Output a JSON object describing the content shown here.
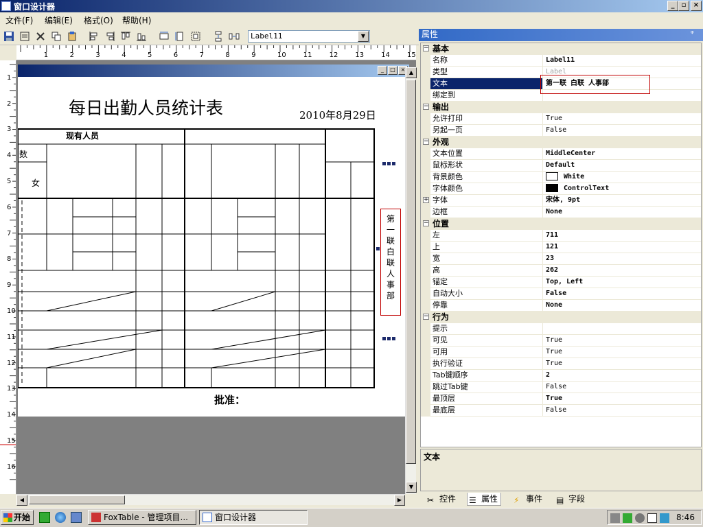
{
  "window": {
    "title": "窗口设计器",
    "btn_min": "_",
    "btn_restore": "▫",
    "btn_close": "×"
  },
  "menu": {
    "items": [
      "文件(F)",
      "编辑(E)",
      "格式(O)",
      "帮助(H)"
    ]
  },
  "toolbar": {
    "selected_control": "Label11"
  },
  "ruler": {
    "h_labels": [
      "1",
      "2",
      "3",
      "4",
      "5",
      "6",
      "7",
      "8",
      "9",
      "10",
      "11",
      "12",
      "13",
      "14",
      "15"
    ],
    "v_labels": [
      "1",
      "2",
      "3",
      "4",
      "5",
      "6",
      "7",
      "8",
      "9",
      "10",
      "11",
      "12",
      "13",
      "14",
      "15",
      "16"
    ]
  },
  "form": {
    "title": "每日出勤人员统计表",
    "date": "2010年8月29日",
    "col_current": "现有人员",
    "cell_shu": "数",
    "cell_nv": "女",
    "approve": "批准：",
    "label11_text": "第一联白联人事部"
  },
  "props": {
    "header": "属性",
    "pin": "ᵠ",
    "categories": {
      "basic": "基本",
      "output": "输出",
      "appearance": "外观",
      "position": "位置",
      "behavior": "行为"
    },
    "rows": {
      "name": {
        "k": "名称",
        "v": "Label11"
      },
      "type": {
        "k": "类型",
        "v": "Label"
      },
      "text": {
        "k": "文本",
        "v": "第一联   白联    人事部"
      },
      "bindto": {
        "k": "绑定到",
        "v": ""
      },
      "allowprint": {
        "k": "允许打印",
        "v": "True"
      },
      "newpage": {
        "k": "另起一页",
        "v": "False"
      },
      "textalign": {
        "k": "文本位置",
        "v": "MiddleCenter"
      },
      "cursor": {
        "k": "鼠标形状",
        "v": "Default"
      },
      "backcolor": {
        "k": "背景颜色",
        "v": "White"
      },
      "forecolor": {
        "k": "字体颜色",
        "v": "ControlText"
      },
      "font": {
        "k": "字体",
        "v": "宋体, 9pt"
      },
      "border": {
        "k": "边框",
        "v": "None"
      },
      "left": {
        "k": "左",
        "v": "711"
      },
      "top": {
        "k": "上",
        "v": "121"
      },
      "width": {
        "k": "宽",
        "v": "23"
      },
      "height": {
        "k": "高",
        "v": "262"
      },
      "anchor": {
        "k": "锚定",
        "v": "Top, Left"
      },
      "autosize": {
        "k": "自动大小",
        "v": "False"
      },
      "dock": {
        "k": "停靠",
        "v": "None"
      },
      "tooltip": {
        "k": "提示",
        "v": ""
      },
      "visible": {
        "k": "可见",
        "v": "True"
      },
      "enabled": {
        "k": "可用",
        "v": "True"
      },
      "validation": {
        "k": "执行验证",
        "v": "True"
      },
      "tabindex": {
        "k": "Tab键顺序",
        "v": "2"
      },
      "tabstop": {
        "k": "跳过Tab键",
        "v": "False"
      },
      "topmost": {
        "k": "最顶层",
        "v": "True"
      },
      "bottommost": {
        "k": "最底层",
        "v": "False"
      }
    },
    "description_title": "文本",
    "tabs": [
      "控件",
      "属性",
      "事件",
      "字段"
    ],
    "colors": {
      "backcolor": "#ffffff",
      "forecolor": "#000000"
    }
  },
  "taskbar": {
    "start": "开始",
    "tasks": [
      "FoxTable - 管理项目...",
      "窗口设计器"
    ],
    "clock": "8:46"
  }
}
